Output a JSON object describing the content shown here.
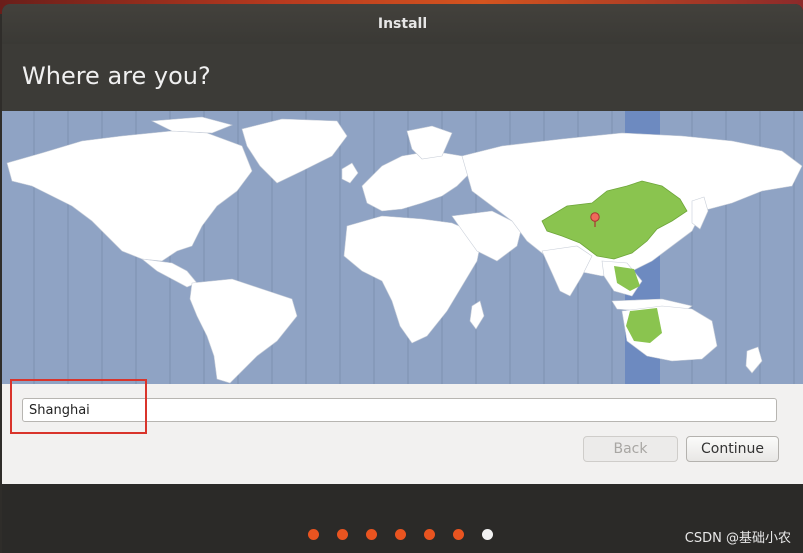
{
  "window": {
    "title": "Install"
  },
  "page": {
    "title": "Where are you?"
  },
  "map": {
    "selected_region": "Asia/Shanghai",
    "highlight_color": "#8ac44f",
    "marker_color": "#ef6a5a"
  },
  "location": {
    "value": "Shanghai"
  },
  "buttons": {
    "back_label": "Back",
    "continue_label": "Continue",
    "back_enabled": false
  },
  "progress": {
    "total_steps": 7,
    "current_step": 7,
    "dot_color": "#e95420"
  },
  "watermark": "CSDN @基础小农",
  "colors": {
    "accent": "#e95420",
    "header": "#3c3b37",
    "ocean": "#8fa3c4"
  }
}
